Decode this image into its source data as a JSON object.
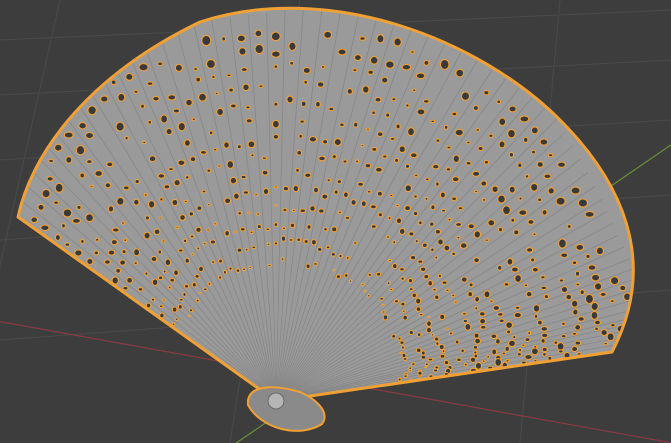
{
  "viewport": {
    "background_color": "#3d3d3d",
    "grid_color": "#4a4a4a",
    "x_axis_color": "#8a3a44",
    "y_axis_color": "#6a8f3a",
    "selection_outline_color": "#f0a035",
    "mesh_color": "#9a9a9a",
    "hole_color": "#3a3a3a"
  },
  "scene": {
    "object": "fan-mesh",
    "selected": true,
    "icons": [
      "fan-mesh-icon",
      "pivot-sphere-icon"
    ]
  }
}
